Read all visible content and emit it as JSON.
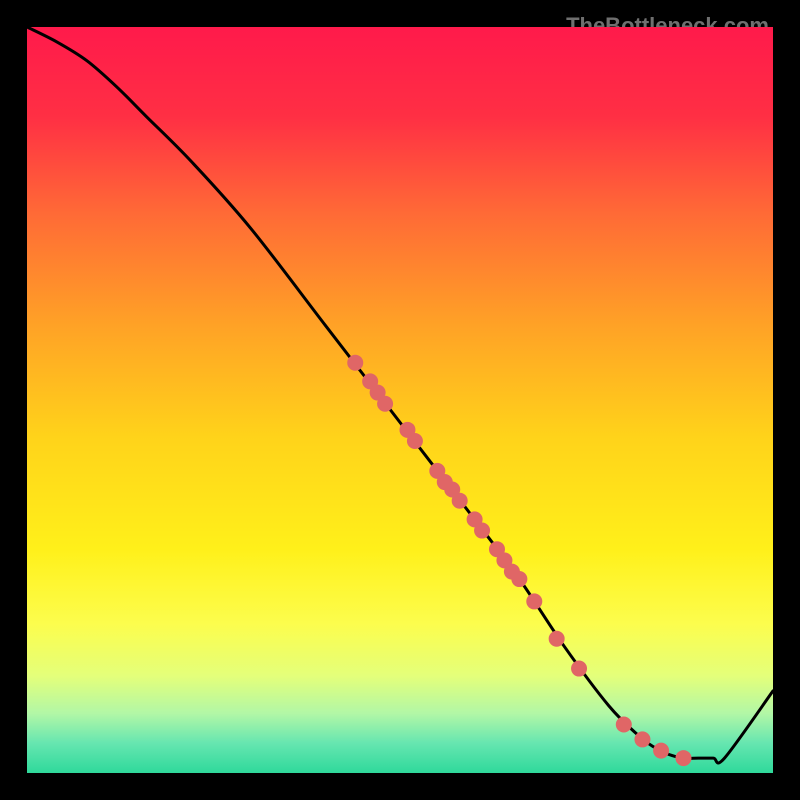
{
  "watermark": "TheBottleneck.com",
  "chart_data": {
    "type": "line",
    "title": "",
    "xlabel": "",
    "ylabel": "",
    "xlim": [
      0,
      100
    ],
    "ylim": [
      0,
      100
    ],
    "gradient_stops": [
      {
        "offset": 0.0,
        "color": "#ff1a4b"
      },
      {
        "offset": 0.12,
        "color": "#ff2f44"
      },
      {
        "offset": 0.25,
        "color": "#ff6a36"
      },
      {
        "offset": 0.4,
        "color": "#ffa226"
      },
      {
        "offset": 0.55,
        "color": "#ffd31a"
      },
      {
        "offset": 0.7,
        "color": "#fff01a"
      },
      {
        "offset": 0.8,
        "color": "#fcfd4d"
      },
      {
        "offset": 0.87,
        "color": "#e4ff7a"
      },
      {
        "offset": 0.92,
        "color": "#b2f7a6"
      },
      {
        "offset": 0.96,
        "color": "#66e6b0"
      },
      {
        "offset": 1.0,
        "color": "#2fd99b"
      }
    ],
    "series": [
      {
        "name": "curve",
        "x": [
          0,
          4,
          8,
          12,
          16,
          22,
          30,
          40,
          50,
          60,
          66,
          72,
          78,
          82,
          84,
          86,
          88,
          90,
          92,
          93.5,
          100
        ],
        "y": [
          100,
          98,
          95.5,
          92,
          88,
          82,
          73,
          60,
          47,
          34,
          26,
          17,
          9,
          5,
          3.5,
          2.5,
          2,
          2,
          2,
          2,
          11
        ]
      }
    ],
    "points": {
      "name": "markers",
      "color": "#e06666",
      "x": [
        44,
        46,
        47,
        48,
        51,
        52,
        55,
        56,
        57,
        58,
        60,
        61,
        63,
        64,
        65,
        66,
        68,
        71,
        74,
        80,
        82.5,
        85,
        88
      ],
      "y": [
        55,
        52.5,
        51,
        49.5,
        46,
        44.5,
        40.5,
        39,
        38,
        36.5,
        34,
        32.5,
        30,
        28.5,
        27,
        26,
        23,
        18,
        14,
        6.5,
        4.5,
        3,
        2
      ]
    }
  }
}
